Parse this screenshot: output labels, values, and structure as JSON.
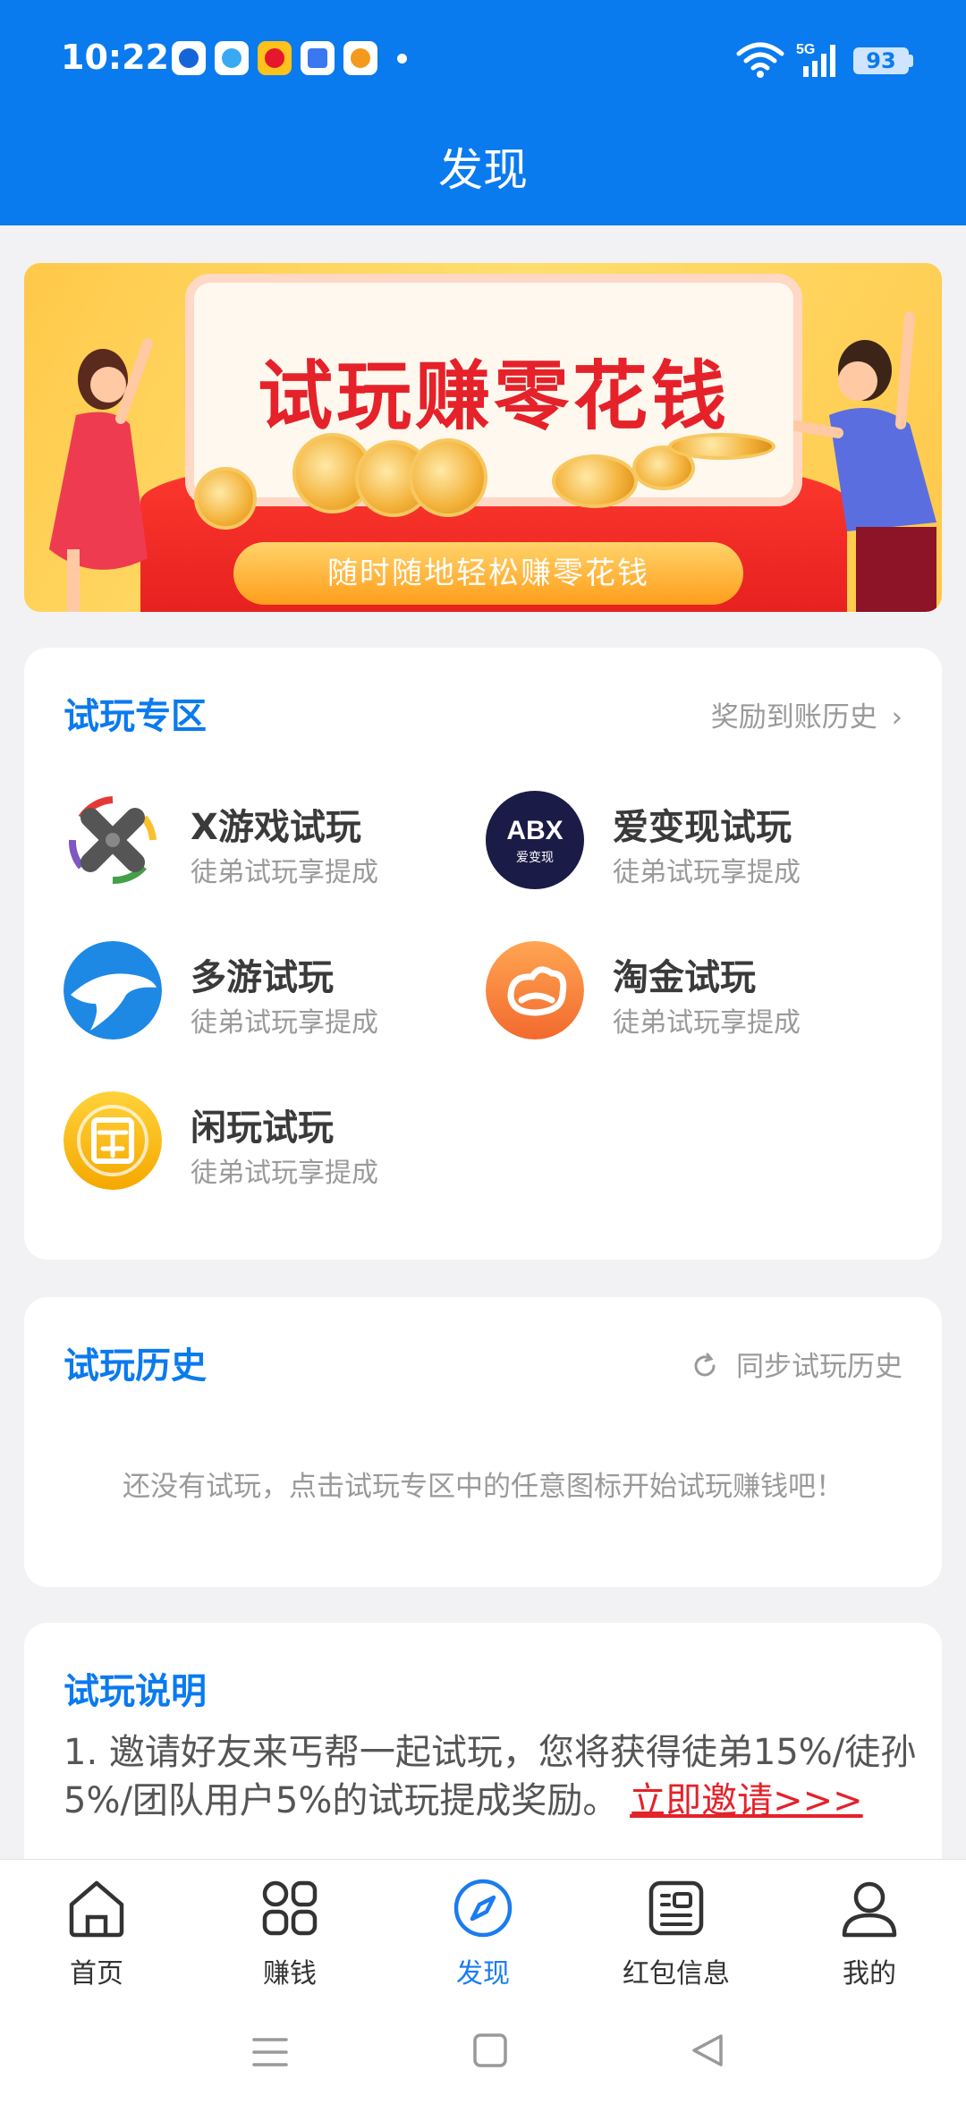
{
  "status_bar": {
    "time": "10:22",
    "battery": "93",
    "network": "5G",
    "notification_icons": [
      "app-icon-blue-target",
      "app-icon-blue-swirl",
      "weibo-icon",
      "message-icon",
      "tiger-app-icon"
    ]
  },
  "header": {
    "title": "发现"
  },
  "banner": {
    "title": "试玩赚零花钱",
    "button_label": "随时随地轻松赚零花钱"
  },
  "trial_zone": {
    "title": "试玩专区",
    "history_link": "奖励到账历史",
    "apps": [
      {
        "name": "X游戏试玩",
        "desc": "徒弟试玩享提成",
        "icon": "x-game-icon"
      },
      {
        "name": "爱变现试玩",
        "desc": "徒弟试玩享提成",
        "icon": "abx-icon",
        "icon_text": "ABX",
        "icon_subtext": "爱变现"
      },
      {
        "name": "多游试玩",
        "desc": "徒弟试玩享提成",
        "icon": "dolphin-icon"
      },
      {
        "name": "淘金试玩",
        "desc": "徒弟试玩享提成",
        "icon": "gold-cloud-icon"
      },
      {
        "name": "闲玩试玩",
        "desc": "徒弟试玩享提成",
        "icon": "xianwan-icon"
      }
    ]
  },
  "trial_history": {
    "title": "试玩历史",
    "sync_label": "同步试玩历史",
    "empty_text": "还没有试玩，点击试玩专区中的任意图标开始试玩赚钱吧！"
  },
  "trial_description": {
    "title": "试玩说明",
    "text": "1. 邀请好友来丐帮一起试玩，您将获得徒弟15%/徒孙5%/团队用户5%的试玩提成奖励。",
    "link": "立即邀请>>>"
  },
  "bottom_nav": {
    "items": [
      {
        "label": "首页",
        "icon": "home-icon"
      },
      {
        "label": "赚钱",
        "icon": "grid-icon"
      },
      {
        "label": "发现",
        "icon": "compass-icon",
        "active": true
      },
      {
        "label": "红包信息",
        "icon": "news-icon"
      },
      {
        "label": "我的",
        "icon": "user-icon"
      }
    ]
  },
  "colors": {
    "primary": "#0a7aef",
    "accent_red": "#e5212a",
    "background": "#f2f2f4"
  }
}
